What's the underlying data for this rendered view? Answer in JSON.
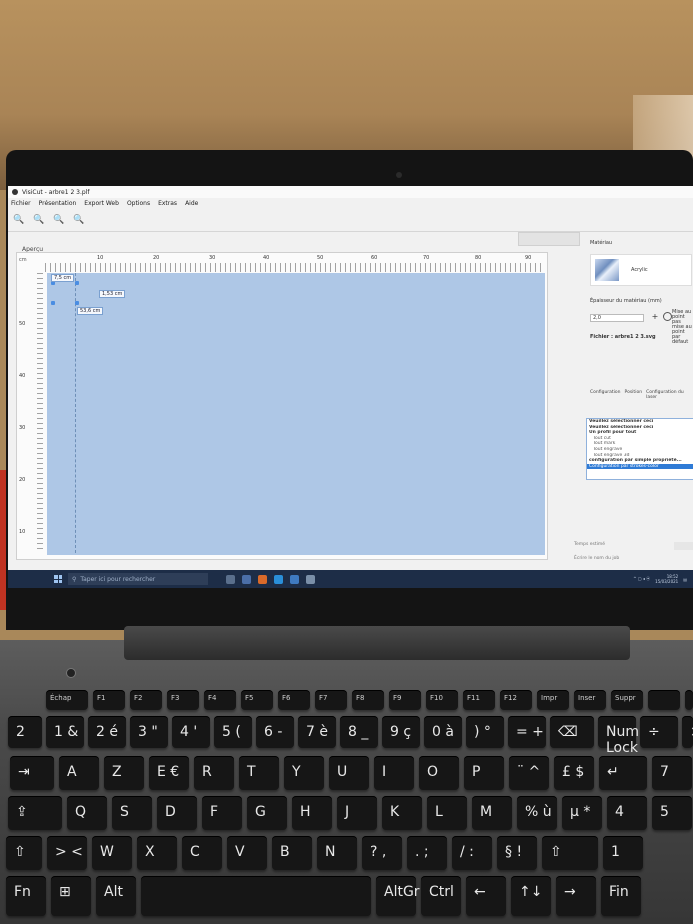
{
  "window": {
    "title": "VisiCut - arbre1 2 3.plf"
  },
  "menu": [
    "Fichier",
    "Présentation",
    "Export Web",
    "Options",
    "Extras",
    "Aide"
  ],
  "toolbar": {
    "icons": [
      "zoom-out-icon",
      "zoom-in-icon",
      "zoom-fit-icon",
      "zoom-reset-icon"
    ]
  },
  "preview": {
    "label": "Aperçu",
    "unit": "cm",
    "top_ticks": [
      "10",
      "20",
      "30",
      "40",
      "50",
      "60",
      "70",
      "80",
      "90"
    ],
    "left_ticks": [
      "50",
      "40",
      "30",
      "20",
      "10"
    ],
    "measure_width": "7,5 cm",
    "measure_height": "1,53 cm",
    "measure_pos": "53,6 cm"
  },
  "side": {
    "material_label": "Matériau",
    "material_name": "Acrylic",
    "thickness_label": "Épaisseur du matériau (mm)",
    "thickness_value": "2,0",
    "radio_label": "Mise au point pas mise au point par défaut",
    "file_label": "Fichier : arbre1 2 3.svg",
    "tabs": [
      "Configuration",
      "Position",
      "Configuration du laser"
    ],
    "list": [
      {
        "text": "Veuillez sélectionner ceci",
        "style": "b"
      },
      {
        "text": "Veuillez sélectionner ceci",
        "style": "b"
      },
      {
        "text": "Un profil pour tout",
        "style": "b"
      },
      {
        "text": "Tout cut",
        "style": "ind"
      },
      {
        "text": "Tout mark",
        "style": "ind"
      },
      {
        "text": "Tout engrave",
        "style": "ind"
      },
      {
        "text": "Tout engrave 3d",
        "style": "ind"
      },
      {
        "text": "configuration par simple propriété...",
        "style": "b"
      },
      {
        "text": "Configuration par strokes-color",
        "style": "sel"
      }
    ],
    "bottom1": "Temps estimé",
    "bottom2": "Écrire le nom du job"
  },
  "taskbar": {
    "search_placeholder": "Taper ici pour rechercher",
    "time": "18:52",
    "date": "15/03/2021"
  },
  "keyboard": {
    "row_f": [
      "Échap",
      "F1",
      "F2",
      "F3",
      "F4",
      "F5",
      "F6",
      "F7",
      "F8",
      "F9",
      "F10",
      "F11",
      "F12",
      "Impr",
      "Inser",
      "Suppr",
      "",
      ""
    ],
    "row_num": [
      "2",
      "1 &",
      "2 é",
      "3 \"",
      "4 '",
      "5 (",
      "6 -",
      "7 è",
      "8 _",
      "9 ç",
      "0 à",
      ") °",
      "= +",
      "⌫",
      "Num Lock",
      "÷",
      "×"
    ],
    "row_a": [
      "⇥",
      "A",
      "Z",
      "E €",
      "R",
      "T",
      "Y",
      "U",
      "I",
      "O",
      "P",
      "¨ ^",
      "£ $",
      "↵",
      "7",
      "8"
    ],
    "row_q": [
      "⇪",
      "Q",
      "S",
      "D",
      "F",
      "G",
      "H",
      "J",
      "K",
      "L",
      "M",
      "% ù",
      "µ *",
      "4",
      "5"
    ],
    "row_w": [
      "⇧",
      "> <",
      "W",
      "X",
      "C",
      "V",
      "B",
      "N",
      "? ,",
      ". ;",
      "/ :",
      "§ !",
      "⇧",
      "1"
    ],
    "row_bot": [
      "Fn",
      "⊞",
      "Alt",
      "",
      "AltGr",
      "Ctrl",
      "←",
      "↑↓",
      "→",
      "Fin"
    ]
  }
}
